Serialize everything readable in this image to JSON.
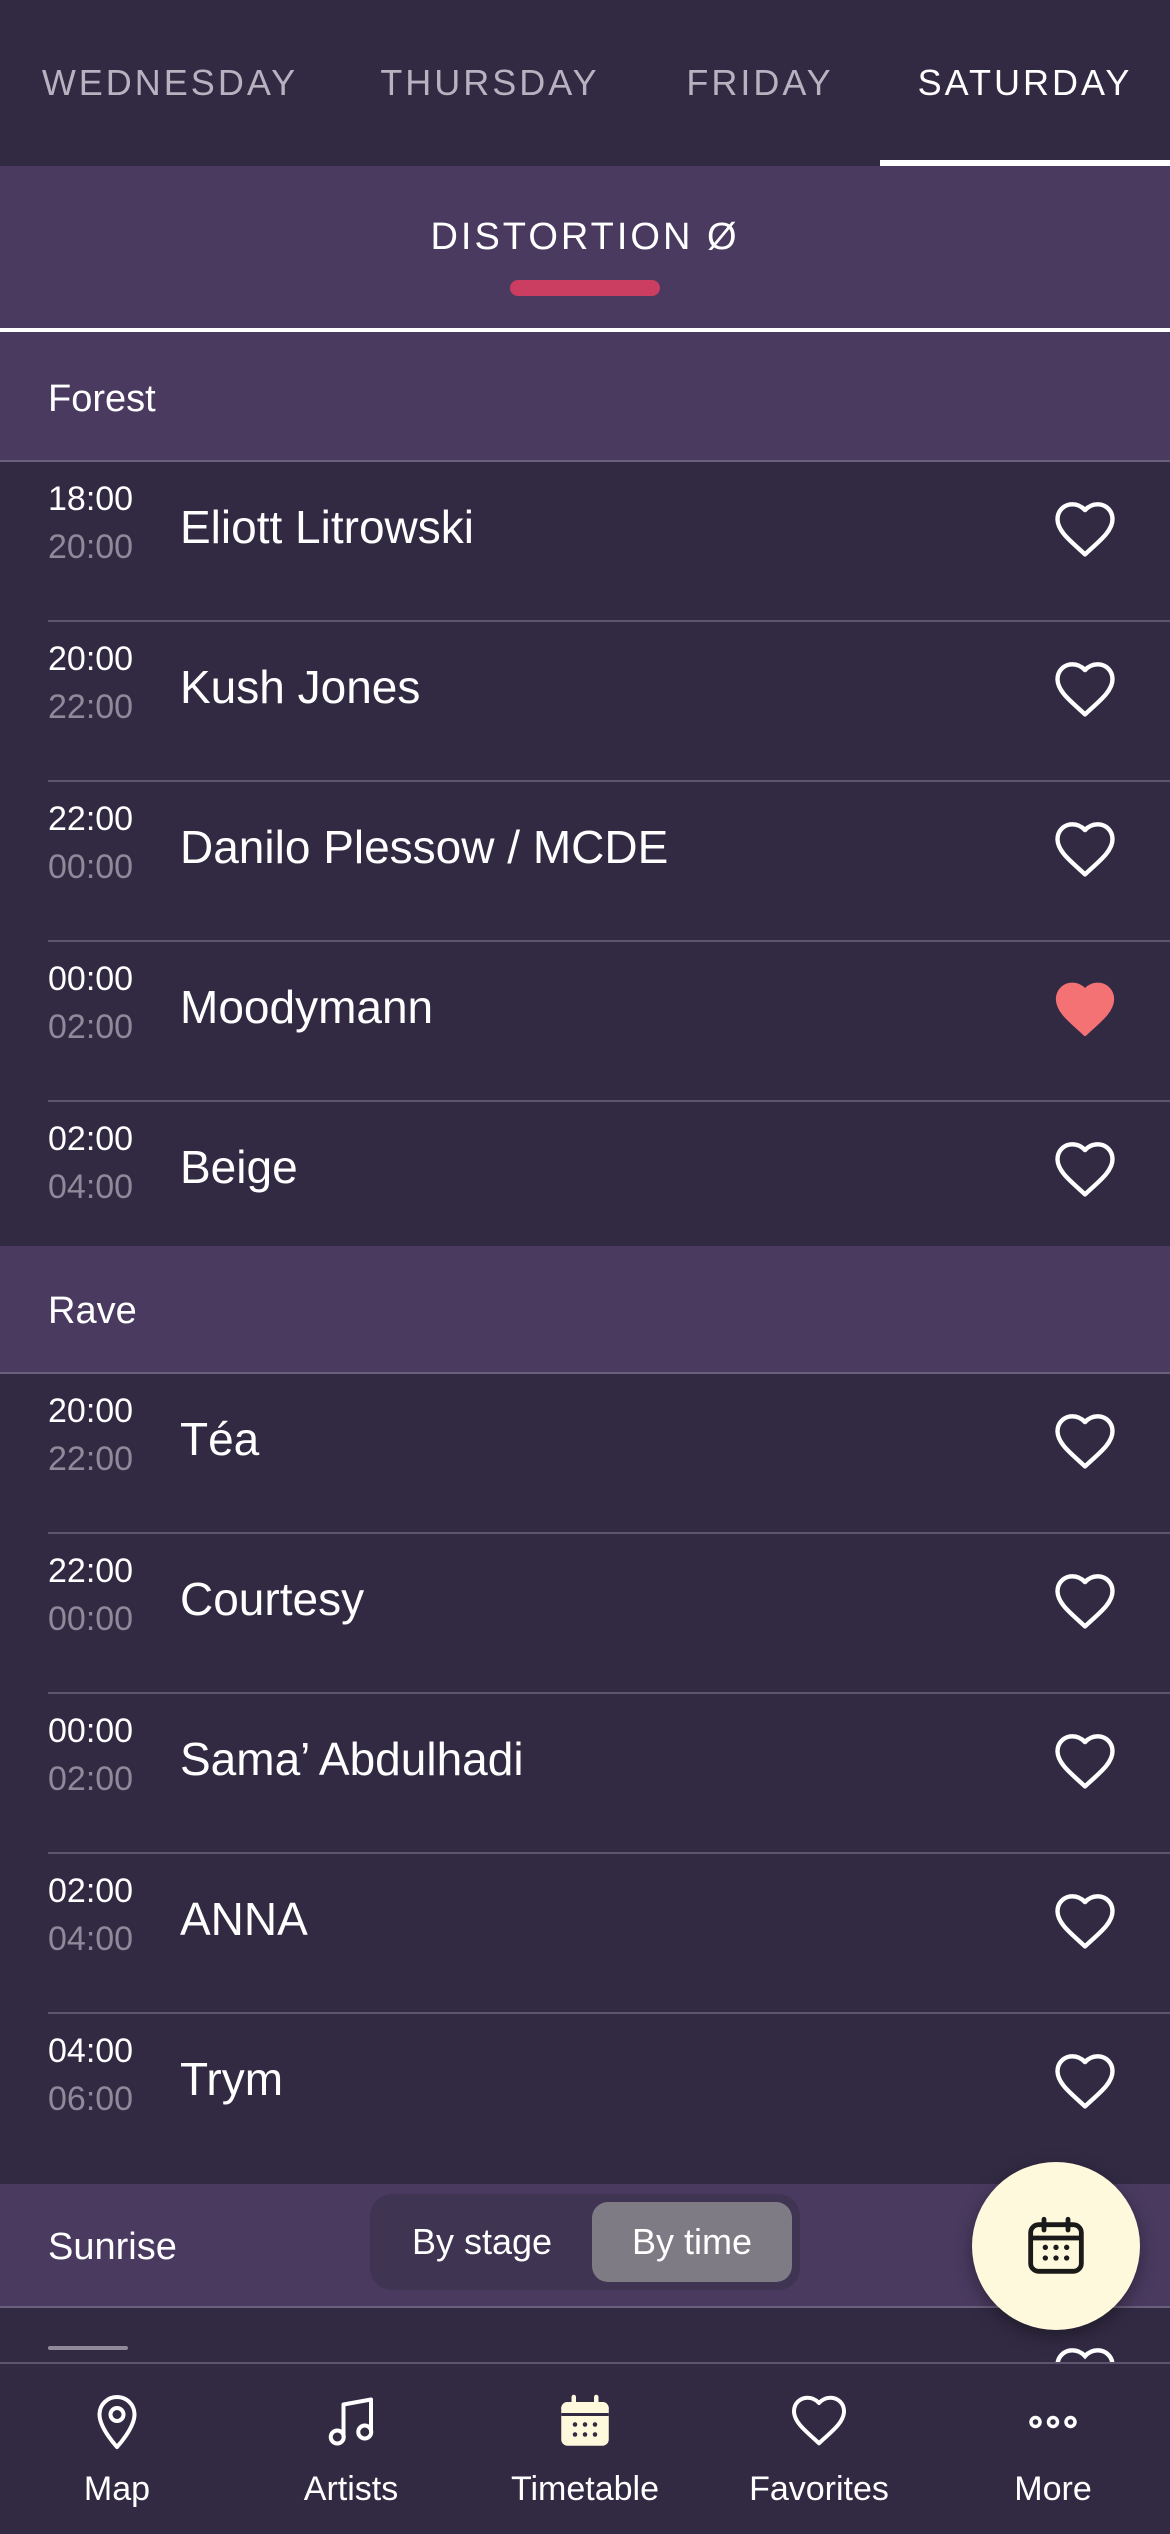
{
  "days": [
    {
      "label": "WEDNESDAY",
      "active": false
    },
    {
      "label": "THURSDAY",
      "active": false
    },
    {
      "label": "FRIDAY",
      "active": false
    },
    {
      "label": "SATURDAY",
      "active": true
    }
  ],
  "stage": {
    "title": "DISTORTION Ø"
  },
  "sections": [
    {
      "name": "Forest",
      "rows": [
        {
          "start": "18:00",
          "end": "20:00",
          "artist": "Eliott Litrowski",
          "favorite": false
        },
        {
          "start": "20:00",
          "end": "22:00",
          "artist": "Kush Jones",
          "favorite": false
        },
        {
          "start": "22:00",
          "end": "00:00",
          "artist": "Danilo Plessow / MCDE",
          "favorite": false
        },
        {
          "start": "00:00",
          "end": "02:00",
          "artist": "Moodymann",
          "favorite": true
        },
        {
          "start": "02:00",
          "end": "04:00",
          "artist": "Beige",
          "favorite": false
        }
      ]
    },
    {
      "name": "Rave",
      "rows": [
        {
          "start": "20:00",
          "end": "22:00",
          "artist": "Téa",
          "favorite": false
        },
        {
          "start": "22:00",
          "end": "00:00",
          "artist": "Courtesy",
          "favorite": false
        },
        {
          "start": "00:00",
          "end": "02:00",
          "artist": "Sama’ Abdulhadi",
          "favorite": false
        },
        {
          "start": "02:00",
          "end": "04:00",
          "artist": "ANNA",
          "favorite": false
        },
        {
          "start": "04:00",
          "end": "06:00",
          "artist": "Trym",
          "favorite": false
        }
      ]
    },
    {
      "name": "Sunrise",
      "rows": []
    }
  ],
  "view_toggle": {
    "by_stage": "By stage",
    "by_time": "By time",
    "selected": "By time"
  },
  "fab": {
    "icon": "calendar-icon"
  },
  "bottom_nav": [
    {
      "label": "Map",
      "icon": "map-pin-icon"
    },
    {
      "label": "Artists",
      "icon": "music-note-icon"
    },
    {
      "label": "Timetable",
      "icon": "calendar-icon",
      "active": true
    },
    {
      "label": "Favorites",
      "icon": "heart-icon"
    },
    {
      "label": "More",
      "icon": "more-dots-icon"
    }
  ],
  "colors": {
    "background": "#322a43",
    "section": "#4a3a60",
    "accent": "#cc3d62",
    "favorite": "#f47174",
    "fab": "#fef8dc"
  }
}
